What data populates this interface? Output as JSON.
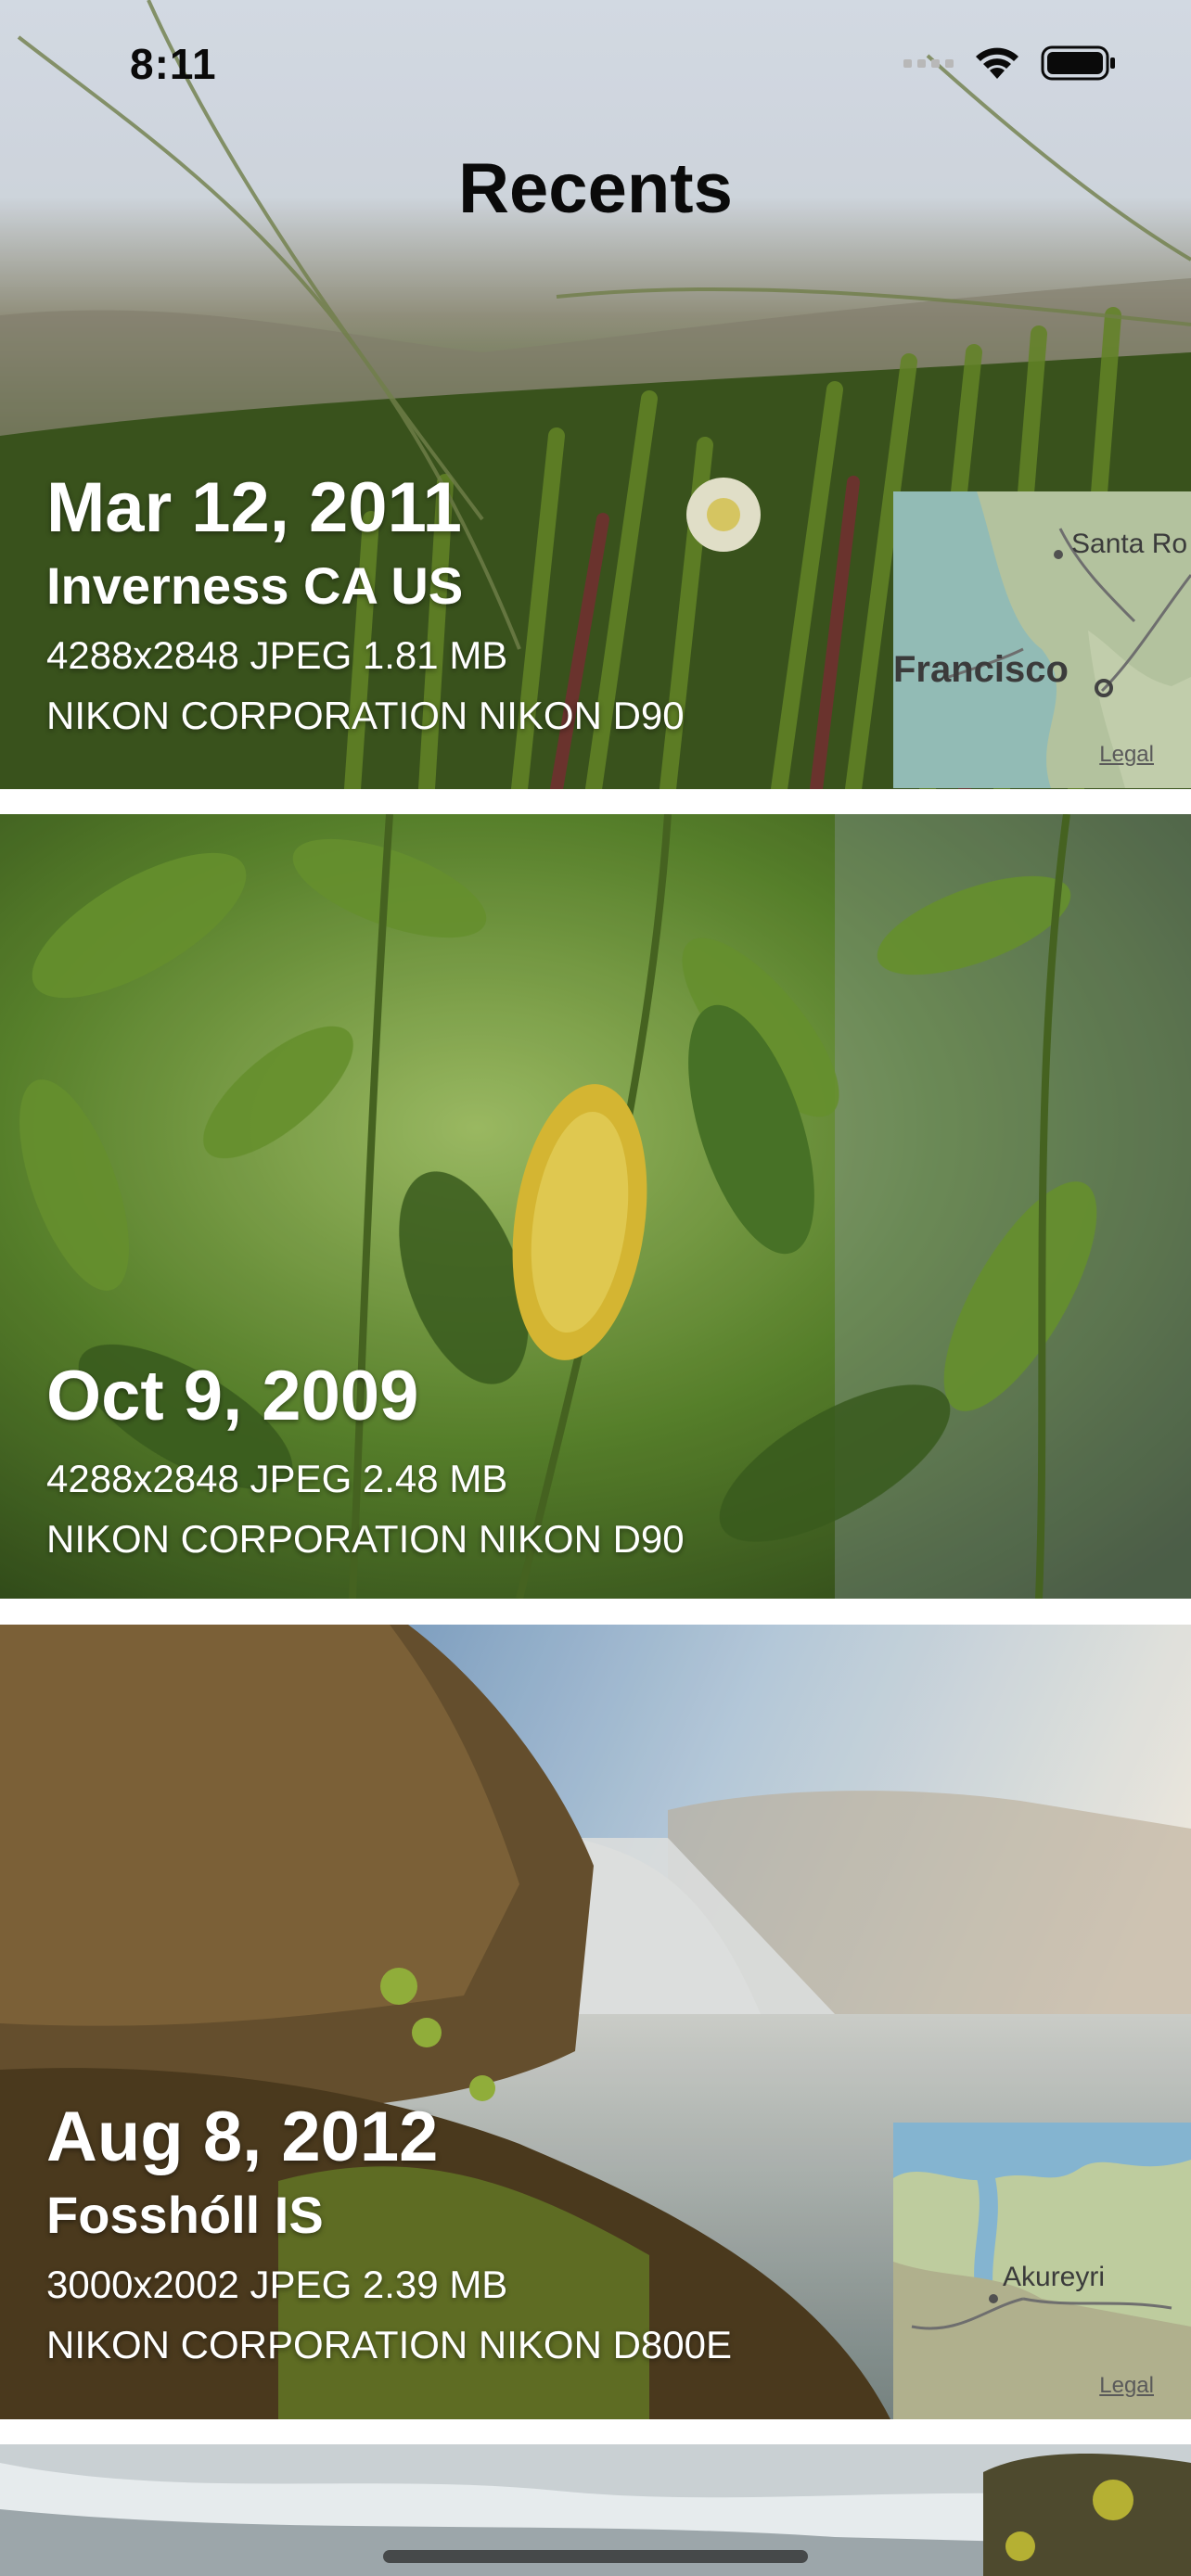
{
  "status_bar": {
    "time": "8:11",
    "icons": [
      "cellular-signal-icon",
      "wifi-icon",
      "battery-icon"
    ]
  },
  "title": "Recents",
  "photos": [
    {
      "date": "Mar 12, 2011",
      "place": "Inverness CA US",
      "details": "4288x2848 JPEG 1.81 MB",
      "camera": "NIKON CORPORATION NIKON D90",
      "map": {
        "labels": [
          "Santa Ro",
          "Francisco"
        ],
        "legal": "Legal"
      }
    },
    {
      "date": "Oct 9, 2009",
      "details": "4288x2848 JPEG 2.48 MB",
      "camera": "NIKON CORPORATION NIKON D90"
    },
    {
      "date": "Aug 8, 2012",
      "place": "Fosshóll IS",
      "details": "3000x2002 JPEG 2.39 MB",
      "camera": "NIKON CORPORATION NIKON D800E",
      "map": {
        "labels": [
          "Akureyri"
        ],
        "legal": "Legal"
      }
    }
  ],
  "colors": {
    "title": "#0a0a0a",
    "caption": "#ffffff",
    "separator": "#ffffff"
  }
}
